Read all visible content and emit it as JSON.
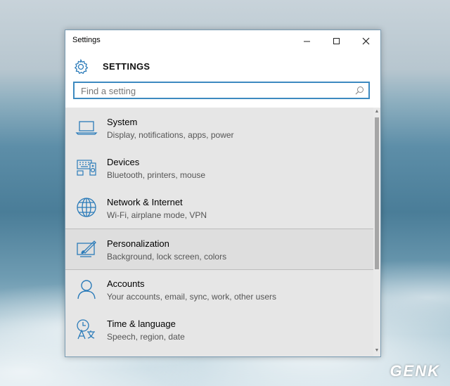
{
  "window": {
    "title": "Settings",
    "minimize": "—",
    "maximize": "☐",
    "close": "✕"
  },
  "header": {
    "title": "SETTINGS",
    "icon": "gear-icon"
  },
  "search": {
    "placeholder": "Find a setting",
    "value": "",
    "icon": "search-icon"
  },
  "items": [
    {
      "title": "System",
      "desc": "Display, notifications, apps, power",
      "icon": "laptop-icon"
    },
    {
      "title": "Devices",
      "desc": "Bluetooth, printers, mouse",
      "icon": "devices-icon"
    },
    {
      "title": "Network & Internet",
      "desc": "Wi-Fi, airplane mode, VPN",
      "icon": "globe-icon"
    },
    {
      "title": "Personalization",
      "desc": "Background, lock screen, colors",
      "icon": "paint-icon"
    },
    {
      "title": "Accounts",
      "desc": "Your accounts, email, sync, work, other users",
      "icon": "person-icon"
    },
    {
      "title": "Time & language",
      "desc": "Speech, region, date",
      "icon": "time-language-icon"
    }
  ],
  "watermark": "GENK",
  "colors": {
    "accent": "#3d8ac0",
    "icon": "#2b7bb9"
  }
}
